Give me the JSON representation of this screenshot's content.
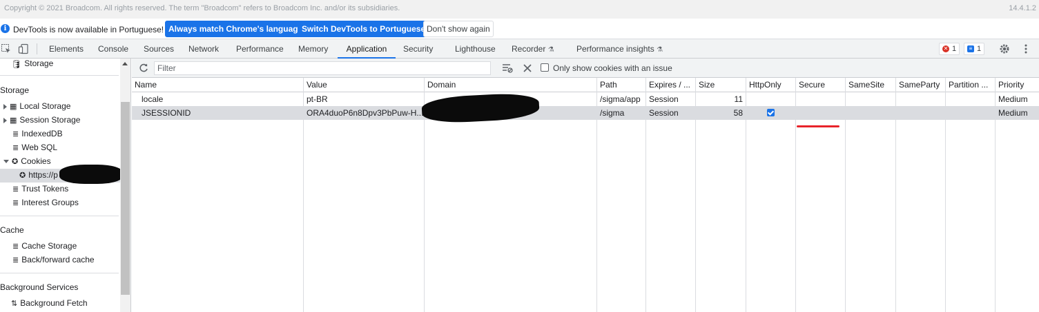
{
  "page": {
    "copyright": "Copyright © 2021 Broadcom. All rights reserved. The term \"Broadcom\" refers to Broadcom Inc. and/or its subsidiaries.",
    "version": "14.4.1.2"
  },
  "infobar": {
    "message": "DevTools is now available in Portuguese!",
    "btn_match": "Always match Chrome's language",
    "btn_switch": "Switch DevTools to Portuguese",
    "btn_dismiss": "Don't show again"
  },
  "tabs": [
    "Elements",
    "Console",
    "Sources",
    "Network",
    "Performance",
    "Memory",
    "Application",
    "Security",
    "Lighthouse",
    "Recorder",
    "Performance insights"
  ],
  "active_tab": "Application",
  "badges": {
    "errors": "1",
    "issues": "1"
  },
  "sidebar": {
    "top_item": "Storage",
    "section_storage": "Storage",
    "local_storage": "Local Storage",
    "session_storage": "Session Storage",
    "indexeddb": "IndexedDB",
    "web_sql": "Web SQL",
    "cookies": "Cookies",
    "cookie_origin": "https://p",
    "trust_tokens": "Trust Tokens",
    "interest_groups": "Interest Groups",
    "section_cache": "Cache",
    "cache_storage": "Cache Storage",
    "bfcache": "Back/forward cache",
    "section_bg": "Background Services",
    "bg_fetch": "Background Fetch"
  },
  "toolbar": {
    "filter_placeholder": "Filter",
    "only_issues_label": "Only show cookies with an issue"
  },
  "table": {
    "columns": [
      "Name",
      "Value",
      "Domain",
      "Path",
      "Expires / ...",
      "Size",
      "HttpOnly",
      "Secure",
      "SameSite",
      "SameParty",
      "Partition ...",
      "Priority"
    ],
    "rows": [
      {
        "name": "locale",
        "value": "pt-BR",
        "domain": "",
        "path": "/sigma/app",
        "expires": "Session",
        "size": "11",
        "httponly": false,
        "priority": "Medium"
      },
      {
        "name": "JSESSIONID",
        "value": "ORA4duoP6n8Dpv3PbPuw-H...",
        "domain": "",
        "path": "/sigma",
        "expires": "Session",
        "size": "58",
        "httponly": true,
        "priority": "Medium"
      }
    ]
  },
  "colors": {
    "accent": "#1a73e8",
    "annotation": "#e8232a",
    "error": "#d93025"
  }
}
